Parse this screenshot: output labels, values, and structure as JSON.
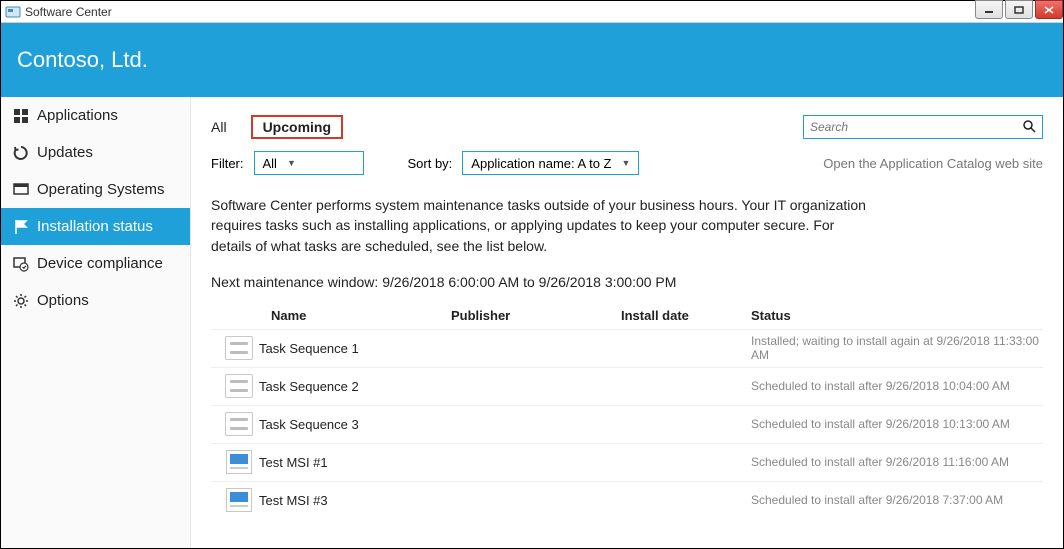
{
  "window": {
    "title": "Software Center"
  },
  "brand": {
    "company": "Contoso, Ltd."
  },
  "sidebar": {
    "items": [
      {
        "label": "Applications",
        "icon": "apps"
      },
      {
        "label": "Updates",
        "icon": "updates"
      },
      {
        "label": "Operating Systems",
        "icon": "os"
      },
      {
        "label": "Installation status",
        "icon": "flag",
        "active": true
      },
      {
        "label": "Device compliance",
        "icon": "compliance"
      },
      {
        "label": "Options",
        "icon": "gear"
      }
    ]
  },
  "tabs": {
    "all": "All",
    "upcoming": "Upcoming",
    "active": "upcoming"
  },
  "search": {
    "placeholder": "Search"
  },
  "filters": {
    "filter_label": "Filter:",
    "filter_value": "All",
    "sort_label": "Sort by:",
    "sort_value": "Application name: A to Z"
  },
  "catalog_link": "Open the Application Catalog web site",
  "description": "Software Center performs system maintenance tasks outside of your business hours. Your IT organization requires tasks such as installing applications, or applying updates to keep your computer secure. For details of what tasks are scheduled, see the list below.",
  "next_window": "Next maintenance window: 9/26/2018 6:00:00 AM to 9/26/2018 3:00:00 PM",
  "columns": {
    "name": "Name",
    "publisher": "Publisher",
    "install_date": "Install date",
    "status": "Status"
  },
  "rows": [
    {
      "icon": "ts",
      "name": "Task Sequence 1",
      "publisher": "",
      "install_date": "",
      "status": "Installed; waiting to install again at 9/26/2018 11:33:00 AM"
    },
    {
      "icon": "ts",
      "name": "Task Sequence 2",
      "publisher": "",
      "install_date": "",
      "status": "Scheduled to install after 9/26/2018 10:04:00 AM"
    },
    {
      "icon": "ts",
      "name": "Task Sequence 3",
      "publisher": "",
      "install_date": "",
      "status": "Scheduled to install after 9/26/2018 10:13:00 AM"
    },
    {
      "icon": "msi",
      "name": "Test MSI #1",
      "publisher": "",
      "install_date": "",
      "status": "Scheduled to install after 9/26/2018 11:16:00 AM"
    },
    {
      "icon": "msi",
      "name": "Test MSI #3",
      "publisher": "",
      "install_date": "",
      "status": "Scheduled to install after 9/26/2018 7:37:00 AM"
    }
  ]
}
